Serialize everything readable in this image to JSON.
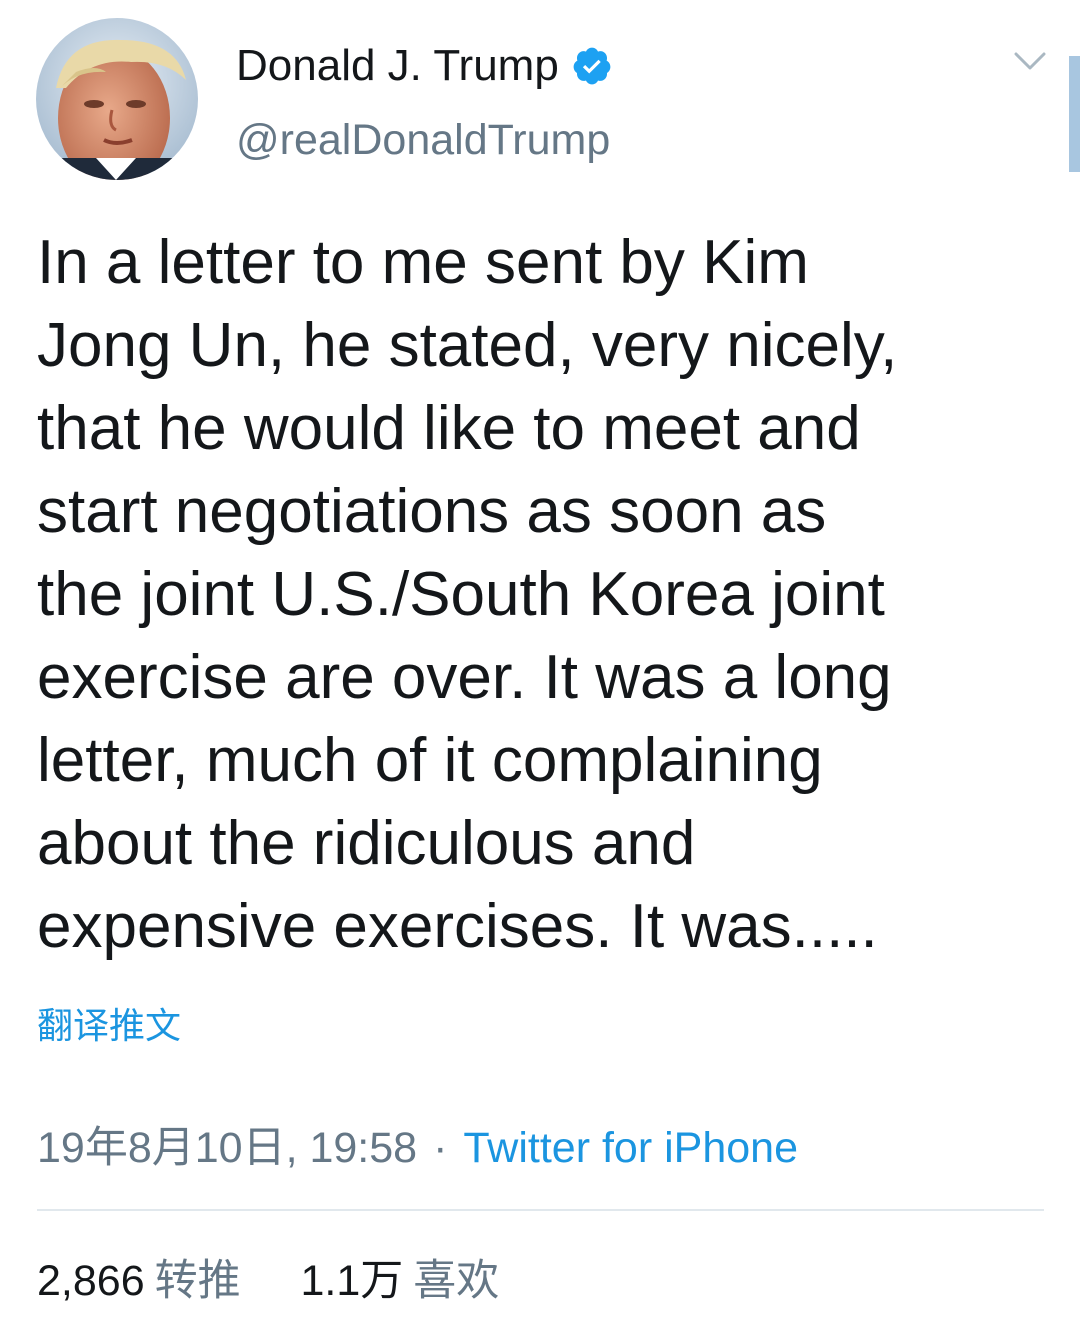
{
  "tweet": {
    "author": {
      "display_name": "Donald J. Trump",
      "handle": "@realDonaldTrump",
      "verified_icon": "verified-badge-icon",
      "avatar_icon": "profile-photo"
    },
    "menu_icon": "chevron-down-icon",
    "text": "In a letter to me sent by Kim\nJong Un, he stated, very nicely,\nthat he would like to meet and\nstart negotiations as soon as\nthe joint U.S./South Korea joint\nexercise are over. It was a long\nletter, much of it complaining\nabout the ridiculous and\nexpensive exercises. It was.....",
    "translate_label": "翻译推文",
    "timestamp": "19年8月10日, 19:58",
    "separator": "·",
    "source": "Twitter for iPhone",
    "stats": {
      "retweets_value": "2,866",
      "retweets_label": "转推",
      "likes_value": "1.1万",
      "likes_label": "喜欢"
    }
  },
  "colors": {
    "link": "#1b95e0",
    "secondary_text": "#657786",
    "primary_text": "#14171a",
    "divider": "#e1e8ed"
  }
}
